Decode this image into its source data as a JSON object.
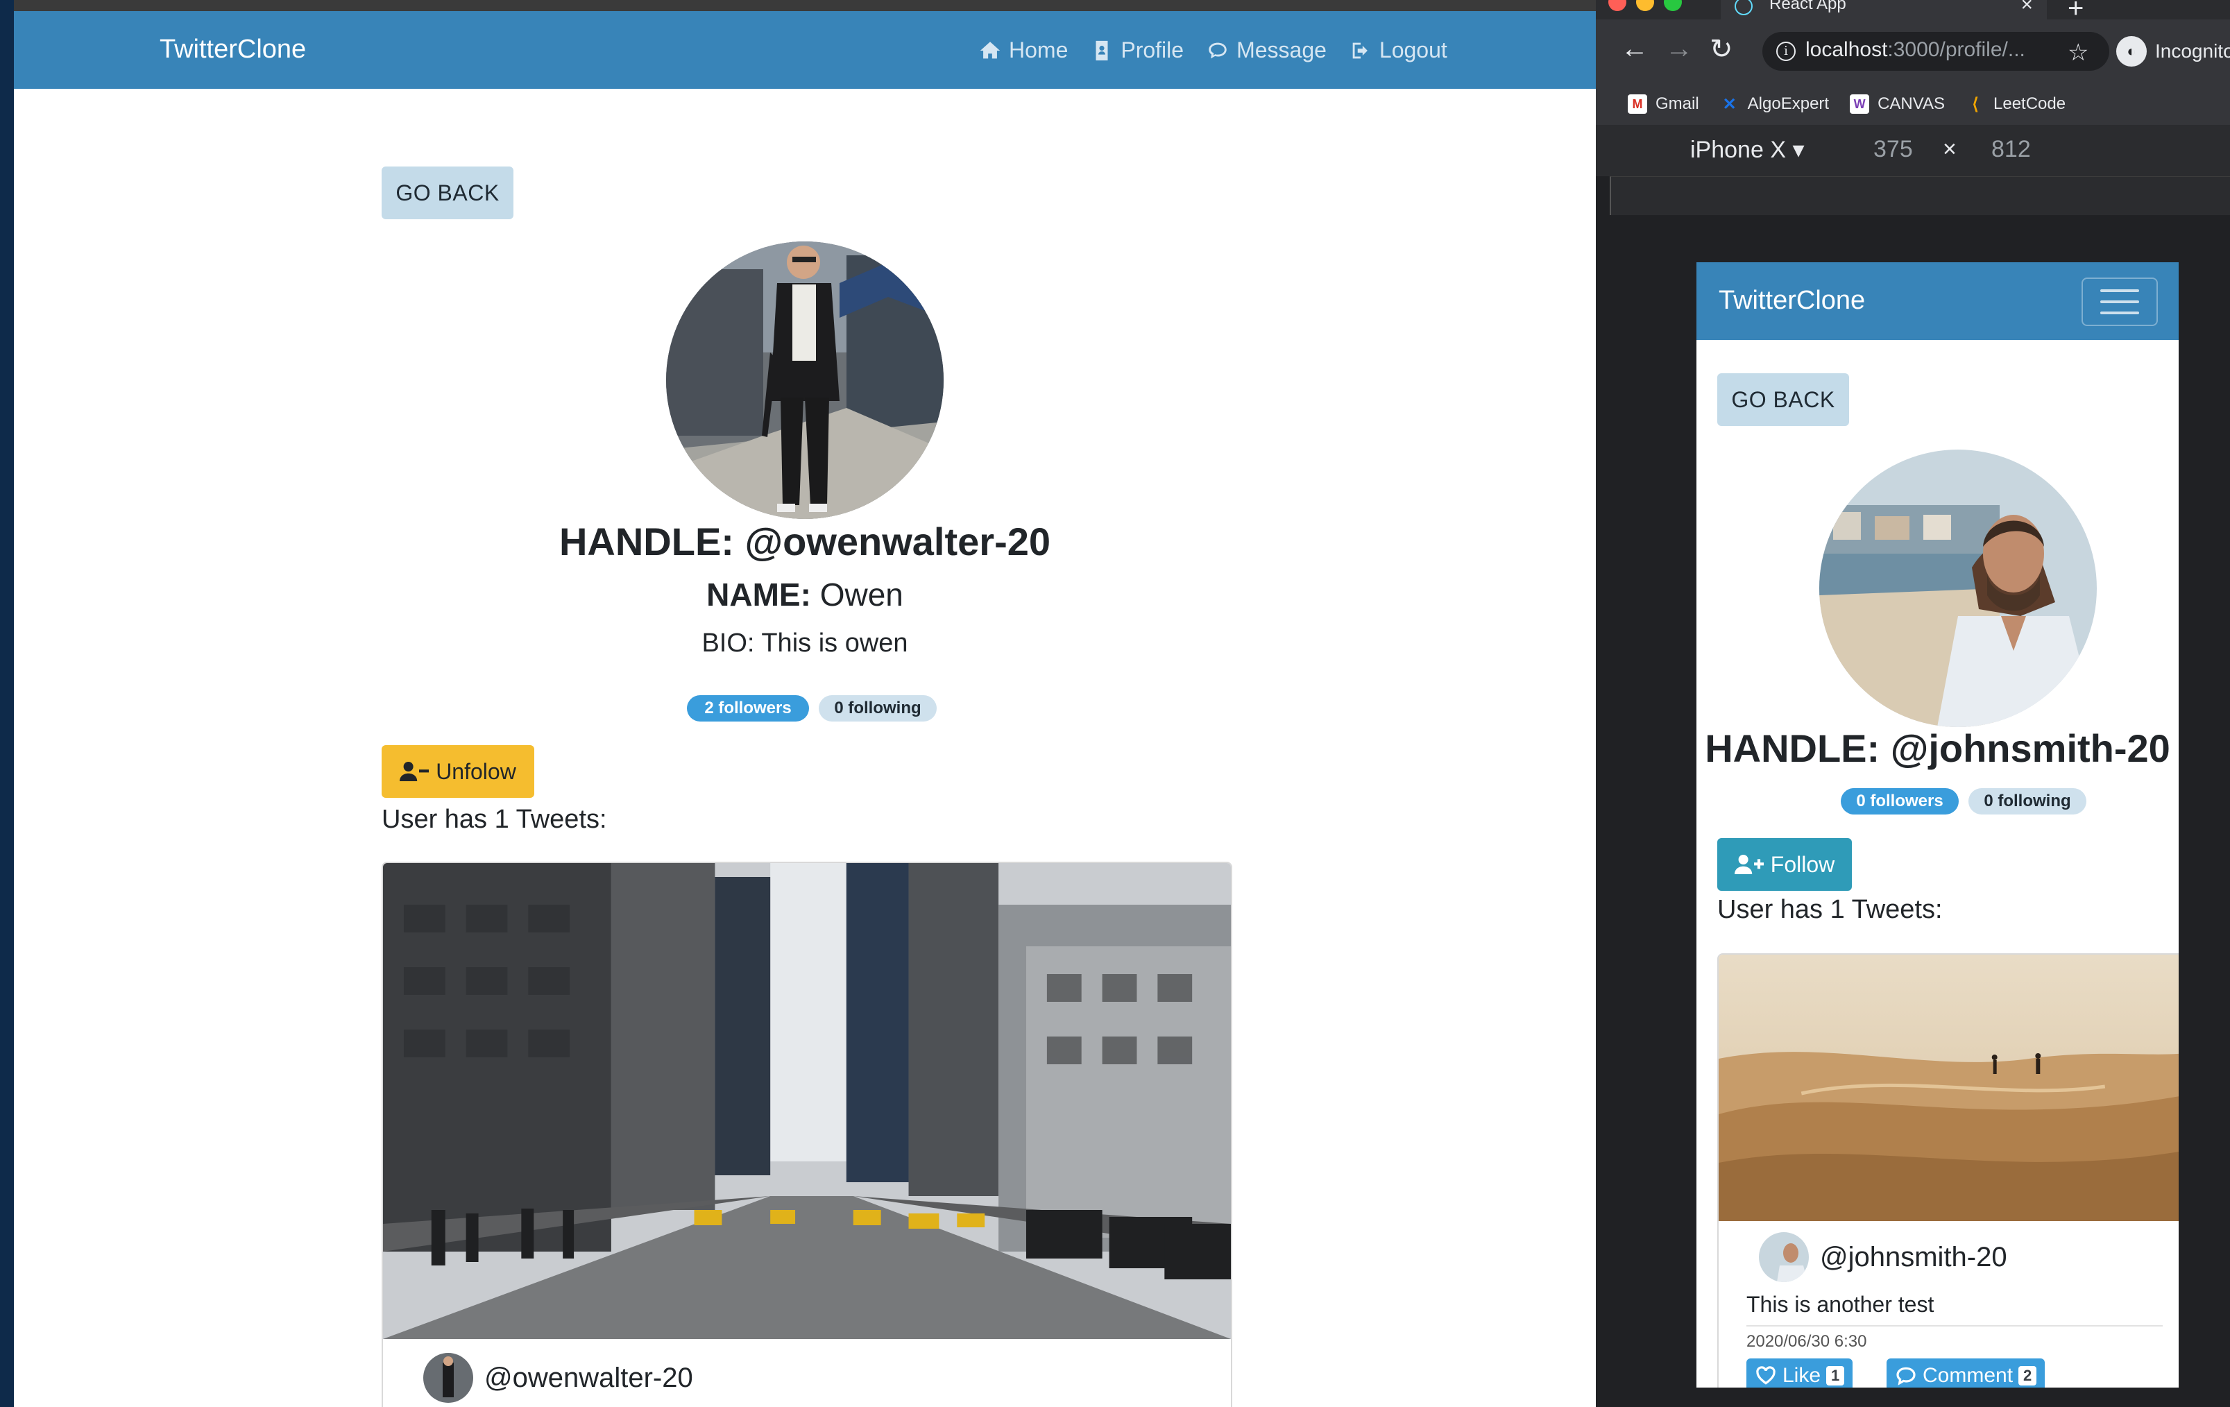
{
  "left_app": {
    "brand": "TwitterClone",
    "nav": [
      {
        "label": "Home",
        "icon": "home-icon"
      },
      {
        "label": "Profile",
        "icon": "id-badge-icon"
      },
      {
        "label": "Message",
        "icon": "chat-bubble-icon"
      },
      {
        "label": "Logout",
        "icon": "sign-out-icon"
      }
    ],
    "go_back": "GO BACK",
    "profile": {
      "handle": "HANDLE: @owenwalter-20",
      "name_label": "NAME:",
      "name_value": "Owen",
      "bio": "BIO: This is owen",
      "followers": "2 followers",
      "following": "0 following"
    },
    "action_button": "Unfolow",
    "tweet_count": "User has 1 Tweets:",
    "tweet": {
      "user": "@owenwalter-20"
    }
  },
  "browser": {
    "tab_title": "React App",
    "url_host": "localhost",
    "url_path": ":3000/profile/...",
    "profile_label": "Incognito",
    "bookmarks": [
      {
        "label": "Gmail",
        "icon": "gmail-icon",
        "color": "#d93025"
      },
      {
        "label": "AlgoExpert",
        "icon": "algoexpert-icon",
        "color": "#1a73e8"
      },
      {
        "label": "CANVAS",
        "icon": "canvas-w-icon",
        "color": "#7b3fb5"
      },
      {
        "label": "LeetCode",
        "icon": "leetcode-icon",
        "color": "#f0a500"
      }
    ],
    "device": {
      "name": "iPhone X ▾",
      "width": "375",
      "times": "×",
      "height": "812"
    }
  },
  "right_app": {
    "brand": "TwitterClone",
    "go_back": "GO BACK",
    "profile": {
      "handle": "HANDLE: @johnsmith-20",
      "followers": "0 followers",
      "following": "0 following"
    },
    "action_button": "Follow",
    "tweet_count": "User has 1 Tweets:",
    "tweet": {
      "user": "@johnsmith-20",
      "text": "This is another test",
      "date": "2020/06/30 6:30",
      "like_label": "Like",
      "like_count": "1",
      "comment_label": "Comment",
      "comment_count": "2"
    }
  },
  "colors": {
    "navbar": "#3884b8",
    "go_back_bg": "#c4dbe9",
    "followers_badge": "#3a9ddc",
    "following_badge": "#cfe1ed",
    "unfollow_btn": "#f5bd2f",
    "follow_btn": "#2f9bb8",
    "action_btn": "#3a9ddc"
  }
}
